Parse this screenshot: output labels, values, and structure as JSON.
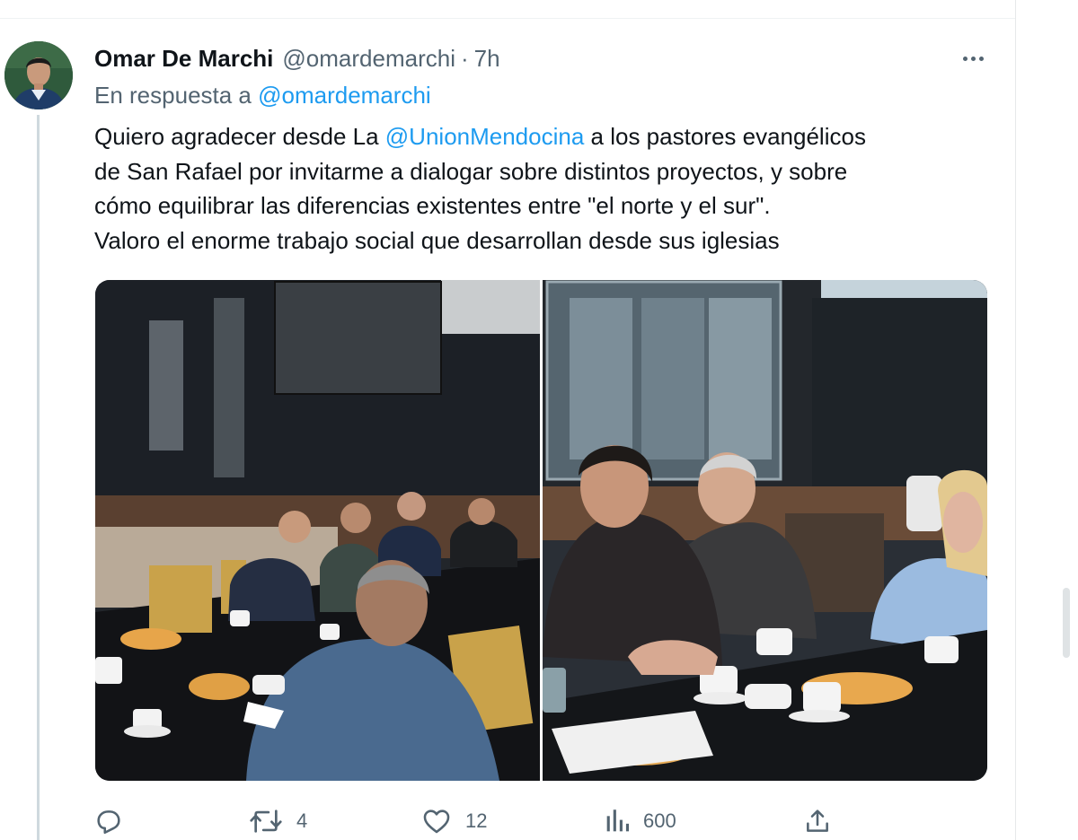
{
  "tweet": {
    "author_name": "Omar De Marchi",
    "author_handle": "@omardemarchi",
    "separator": "·",
    "time": "7h",
    "reply_prefix": "En respuesta a",
    "reply_mention": "@omardemarchi",
    "text": {
      "line1_prefix": "Quiero agradecer desde La ",
      "line1_mention": "@UnionMendocina",
      "line1_suffix": " a los pastores evangélicos",
      "line2": "de San Rafael por invitarme a dialogar sobre distintos proyectos, y sobre",
      "line3": "cómo equilibrar las diferencias existentes entre \"el norte y el sur\".",
      "line4": "Valoro el enorme trabajo social que desarrollan desde sus iglesias"
    }
  },
  "metrics": {
    "replies": "",
    "retweets": "4",
    "likes": "12",
    "views": "600"
  },
  "icons": {
    "avatar": "avatar",
    "more": "more-icon",
    "reply": "reply-icon",
    "retweet": "retweet-icon",
    "like": "heart-icon",
    "views": "views-icon",
    "share": "share-icon"
  },
  "colors": {
    "link": "#1d9bf0",
    "secondary_text": "#536471",
    "primary_text": "#0f1419"
  }
}
